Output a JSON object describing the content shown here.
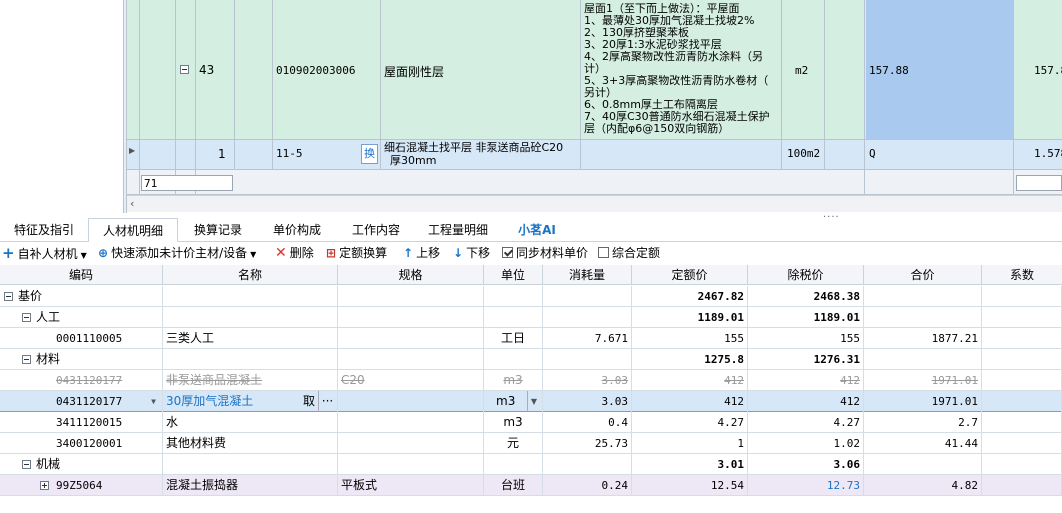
{
  "top_grid": {
    "row43": {
      "index": "43",
      "code": "010902003006",
      "name": "屋面刚性层",
      "features": [
        "屋面1（至下而上做法）：平屋面",
        "1、最薄处30厚加气混凝土找坡2%",
        "2、130厚挤塑聚苯板",
        "3、20厚1:3水泥砂浆找平层",
        "4、2厚高聚物改性沥青防水涂料（另",
        "计）",
        "5、3+3厚高聚物改性沥青防水卷材（",
        "另计）",
        "6、0.8mm厚土工布隔离层",
        "7、40厚C30普通防水细石混凝土保护",
        "层（内配φ6@150双向钢筋）"
      ],
      "unit": "m2",
      "quantity": "157.88",
      "qty2": "157.8"
    },
    "row1": {
      "index": "1",
      "code": "11-5",
      "swap": "换",
      "name_line1": "细石混凝土找平层 非泵送商品砼C20",
      "name_line2": "厚30mm",
      "unit": "100m2",
      "quantity": "Q",
      "qty2": "1.578"
    },
    "input_value": "71"
  },
  "splitter": "....",
  "tabs": [
    "特征及指引",
    "人材机明细",
    "换算记录",
    "单价构成",
    "工作内容",
    "工程量明细",
    "小茗AI"
  ],
  "active_tab": "人材机明细",
  "toolbar": {
    "add_material": "自补人材机",
    "quick_add": "快速添加未计价主材/设备",
    "delete": "删除",
    "quota_convert": "定额换算",
    "move_up": "上移",
    "move_down": "下移",
    "sync_price": "同步材料单价",
    "composite": "综合定额"
  },
  "grid": {
    "headers": [
      "编码",
      "名称",
      "规格",
      "单位",
      "消耗量",
      "定额价",
      "除税价",
      "合价",
      "系数"
    ],
    "rows": [
      {
        "code": "基价",
        "name": "",
        "spec": "",
        "unit": "",
        "qty": "",
        "price": "2467.82",
        "tax_free": "2468.38",
        "total": "",
        "level": 0,
        "group": true
      },
      {
        "code": "人工",
        "name": "",
        "spec": "",
        "unit": "",
        "qty": "",
        "price": "1189.01",
        "tax_free": "1189.01",
        "total": "",
        "level": 1,
        "group": true
      },
      {
        "code": "0001110005",
        "name": "三类人工",
        "spec": "",
        "unit": "工日",
        "qty": "7.671",
        "price": "155",
        "tax_free": "155",
        "total": "1877.21",
        "level": 2
      },
      {
        "code": "材料",
        "name": "",
        "spec": "",
        "unit": "",
        "qty": "",
        "price": "1275.8",
        "tax_free": "1276.31",
        "total": "",
        "level": 1,
        "group": true
      },
      {
        "code": "0431120177",
        "name": "非泵送商品混凝土",
        "spec": "C20",
        "unit": "m3",
        "qty": "3.03",
        "price": "412",
        "tax_free": "412",
        "total": "1971.01",
        "level": 2,
        "strike": true
      },
      {
        "code": "0431120177",
        "name": "30厚加气混凝土",
        "spec": "",
        "unit": "m3",
        "qty": "3.03",
        "price": "412",
        "tax_free": "412",
        "total": "1971.01",
        "level": 2,
        "selected": true,
        "take": "取",
        "more": "···"
      },
      {
        "code": "3411120015",
        "name": "水",
        "spec": "",
        "unit": "m3",
        "qty": "0.4",
        "price": "4.27",
        "tax_free": "4.27",
        "total": "2.7",
        "level": 2
      },
      {
        "code": "3400120001",
        "name": "其他材料费",
        "spec": "",
        "unit": "元",
        "qty": "25.73",
        "price": "1",
        "tax_free": "1.02",
        "total": "41.44",
        "level": 2
      },
      {
        "code": "机械",
        "name": "",
        "spec": "",
        "unit": "",
        "qty": "",
        "price": "3.01",
        "tax_free": "3.06",
        "total": "",
        "level": 1,
        "group": true
      },
      {
        "code": "99Z5064",
        "name": "混凝土振捣器",
        "spec": "平板式",
        "unit": "台班",
        "qty": "0.24",
        "price": "12.54",
        "tax_free": "12.73",
        "total": "4.82",
        "level": 2,
        "machine": true
      }
    ]
  },
  "colors": {
    "row_green": "#d4eee2",
    "row_selected_blue": "#d6e7f7",
    "quantity_cell_blue": "#a9caee",
    "machine_row": "#ede7f6",
    "accent": "#1a73c7"
  }
}
